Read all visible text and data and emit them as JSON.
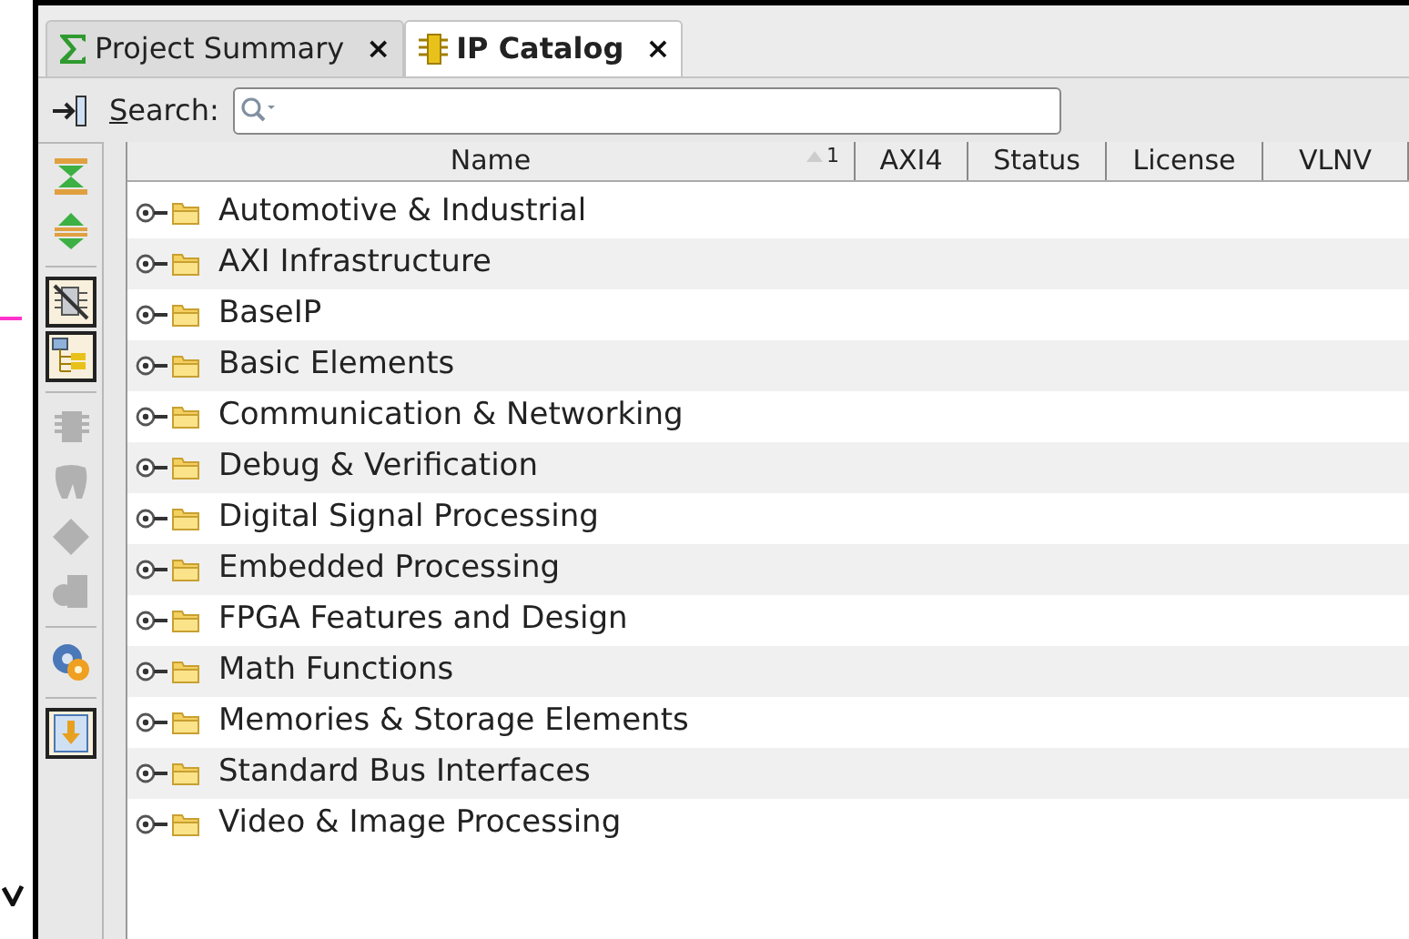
{
  "tabs": [
    {
      "label": "Project Summary",
      "kind": "sigma",
      "selected": false,
      "close": "×"
    },
    {
      "label": "IP Catalog",
      "kind": "chip",
      "selected": true,
      "close": "×"
    }
  ],
  "search": {
    "label": "Search:"
  },
  "side_toolbar": [
    {
      "kind": "collapse",
      "selected": false,
      "disabled": false
    },
    {
      "kind": "expand",
      "selected": false,
      "disabled": false
    },
    {
      "kind": "divider"
    },
    {
      "kind": "hide-incompatible",
      "selected": true,
      "disabled": false
    },
    {
      "kind": "hierarchy",
      "selected": true,
      "disabled": false
    },
    {
      "kind": "divider"
    },
    {
      "kind": "chip",
      "selected": false,
      "disabled": true
    },
    {
      "kind": "tooth",
      "selected": false,
      "disabled": true
    },
    {
      "kind": "diamond",
      "selected": false,
      "disabled": true
    },
    {
      "kind": "document",
      "selected": false,
      "disabled": true
    },
    {
      "kind": "divider"
    },
    {
      "kind": "gear",
      "selected": false,
      "disabled": false
    },
    {
      "kind": "divider"
    },
    {
      "kind": "download",
      "selected": true,
      "disabled": false
    }
  ],
  "table": {
    "columns": [
      {
        "label": "Name",
        "sort_rank": "1"
      },
      {
        "label": "AXI4"
      },
      {
        "label": "Status"
      },
      {
        "label": "License"
      },
      {
        "label": "VLNV"
      }
    ],
    "rows": [
      {
        "name": "Automotive & Industrial",
        "expanded": false
      },
      {
        "name": "AXI Infrastructure",
        "expanded": false
      },
      {
        "name": "BaseIP",
        "expanded": false
      },
      {
        "name": "Basic Elements",
        "expanded": false
      },
      {
        "name": "Communication & Networking",
        "expanded": false
      },
      {
        "name": "Debug & Verification",
        "expanded": false
      },
      {
        "name": "Digital Signal Processing",
        "expanded": false
      },
      {
        "name": "Embedded Processing",
        "expanded": false
      },
      {
        "name": "FPGA Features and Design",
        "expanded": false
      },
      {
        "name": "Math Functions",
        "expanded": false
      },
      {
        "name": "Memories & Storage Elements",
        "expanded": false
      },
      {
        "name": "Standard Bus Interfaces",
        "expanded": false
      },
      {
        "name": "Video & Image Processing",
        "expanded": false
      }
    ]
  }
}
